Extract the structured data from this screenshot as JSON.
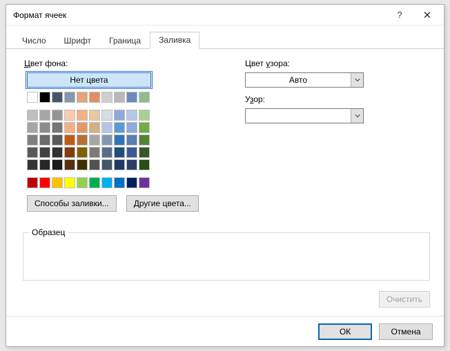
{
  "title": "Формат ячеек",
  "tabs": {
    "number": "Число",
    "font": "Шрифт",
    "border": "Граница",
    "fill": "Заливка"
  },
  "labels": {
    "bg_color_pre": "",
    "bg_color": "Цвет фона:",
    "bg_color_ul": "Ц",
    "no_color": "Нет цвета",
    "fill_effects": "Способы заливки...",
    "more_colors": "Другие цвета...",
    "pattern_color_pre": "Цвет ",
    "pattern_color_ul": "у",
    "pattern_color_post": "зора:",
    "pattern_pre": "У",
    "pattern_ul": "з",
    "pattern_post": "ор:",
    "auto": "Авто",
    "sample": "Образец",
    "clear": "Очистить",
    "ok": "ОК",
    "cancel": "Отмена"
  },
  "palette": {
    "theme_header": [
      "#ffffff",
      "#000000",
      "#44546a",
      "#8497b0",
      "#e7a27a",
      "#e38e64",
      "#cfcfcf",
      "#b8b8b8",
      "#6a8bc0",
      "#8fbc8f"
    ],
    "theme_body": [
      [
        "#bfbfbf",
        "#a6a6a6",
        "#959595",
        "#f8cbad",
        "#f4b183",
        "#e8c8a0",
        "#d6dce5",
        "#8ea9db",
        "#b4c7e7",
        "#a9d18e"
      ],
      [
        "#a6a6a6",
        "#8c8c8c",
        "#767676",
        "#f4b084",
        "#e59866",
        "#d0b184",
        "#b4c6e7",
        "#5b9bd5",
        "#8faadc",
        "#70ad47"
      ],
      [
        "#808080",
        "#6b6b6b",
        "#595959",
        "#c65911",
        "#b86f32",
        "#a6a6a6",
        "#8497b0",
        "#2e75b6",
        "#5a7db4",
        "#548235"
      ],
      [
        "#595959",
        "#404040",
        "#333333",
        "#833c0c",
        "#7f6000",
        "#7b7b7b",
        "#5a6e8c",
        "#1f4e79",
        "#3b5998",
        "#385723"
      ],
      [
        "#333333",
        "#262626",
        "#1a1a1a",
        "#5a2d0c",
        "#3f3000",
        "#525252",
        "#44546a",
        "#203864",
        "#2a3f66",
        "#274e13"
      ]
    ],
    "standard": [
      "#c00000",
      "#ff0000",
      "#ffc000",
      "#ffff00",
      "#92d050",
      "#00b050",
      "#00b0f0",
      "#0070c0",
      "#002060",
      "#7030a0"
    ]
  }
}
